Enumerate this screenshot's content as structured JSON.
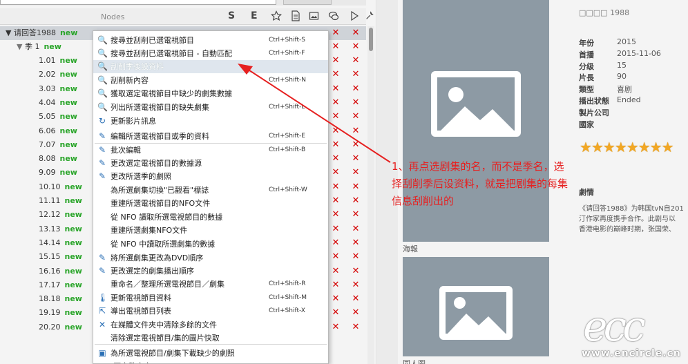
{
  "header": {
    "nodes_label": "Nodes",
    "col_s": "S",
    "col_e": "E"
  },
  "tree": {
    "show": {
      "label": "请回答1988",
      "badge": "new"
    },
    "season": {
      "label": "季 1",
      "badge": "new"
    },
    "episodes": [
      {
        "label": "1.01",
        "badge": "new"
      },
      {
        "label": "2.02",
        "badge": "new"
      },
      {
        "label": "3.03",
        "badge": "new"
      },
      {
        "label": "4.04",
        "badge": "new"
      },
      {
        "label": "5.05",
        "badge": "new"
      },
      {
        "label": "6.06",
        "badge": "new"
      },
      {
        "label": "7.07",
        "badge": "new"
      },
      {
        "label": "8.08",
        "badge": "new"
      },
      {
        "label": "9.09",
        "badge": "new"
      },
      {
        "label": "10.10",
        "badge": "new"
      },
      {
        "label": "11.11",
        "badge": "new"
      },
      {
        "label": "12.12",
        "badge": "new"
      },
      {
        "label": "13.13",
        "badge": "new"
      },
      {
        "label": "14.14",
        "badge": "new"
      },
      {
        "label": "15.15",
        "badge": "new"
      },
      {
        "label": "16.16",
        "badge": "new"
      },
      {
        "label": "17.17",
        "badge": "new"
      },
      {
        "label": "18.18",
        "badge": "new"
      },
      {
        "label": "19.19",
        "badge": "new"
      },
      {
        "label": "20.20",
        "badge": "new"
      }
    ],
    "x_mark": "✕"
  },
  "menu": {
    "items": [
      {
        "icon": "search-icon",
        "glyph": "🔍",
        "text": "搜尋並刮削已選電視節目",
        "shortcut": "Ctrl+Shift-S"
      },
      {
        "icon": "search-icon",
        "glyph": "🔍",
        "text": "搜尋並刮削已選電視節目 - 自動匹配",
        "shortcut": "Ctrl+Shift-F"
      },
      {
        "icon": "search-icon",
        "glyph": "🔍",
        "text": "刮削季後設資料",
        "shortcut": ""
      },
      {
        "icon": "search-icon",
        "glyph": "🔍",
        "text": "刮削新內容",
        "shortcut": "Ctrl+Shift-N"
      },
      {
        "icon": "search-icon",
        "glyph": "🔍",
        "text": "獲取選定電視節目中缺少的劇集數據",
        "shortcut": ""
      },
      {
        "icon": "search-icon",
        "glyph": "🔍",
        "text": "列出所選電視節目的缺失劇集",
        "shortcut": "Ctrl+Shift-L"
      },
      {
        "icon": "refresh-icon",
        "glyph": "↻",
        "text": "更新影片訊息",
        "shortcut": ""
      },
      {
        "icon": "edit-icon",
        "glyph": "✎",
        "text": "編輯所選電視節目或季的資料",
        "shortcut": "Ctrl+Shift-E"
      },
      {
        "icon": "edit-icon",
        "glyph": "✎",
        "text": "批次編輯",
        "shortcut": "Ctrl+Shift-B"
      },
      {
        "icon": "edit-icon",
        "glyph": "✎",
        "text": "更改選定電視節目的數據源",
        "shortcut": ""
      },
      {
        "icon": "edit-icon",
        "glyph": "✎",
        "text": "更改所選季的劇照",
        "shortcut": ""
      },
      {
        "icon": "",
        "glyph": "",
        "text": "為所選劇集切換\"已觀看\"標誌",
        "shortcut": "Ctrl+Shift-W"
      },
      {
        "icon": "",
        "glyph": "",
        "text": "重建所選電視節目的NFO文件",
        "shortcut": ""
      },
      {
        "icon": "",
        "glyph": "",
        "text": "從 NFO 讀取所選電視節目的數據",
        "shortcut": ""
      },
      {
        "icon": "",
        "glyph": "",
        "text": "重建所選劇集NFO文件",
        "shortcut": ""
      },
      {
        "icon": "",
        "glyph": "",
        "text": "從 NFO 中讀取所選劇集的數據",
        "shortcut": ""
      },
      {
        "icon": "edit-icon",
        "glyph": "✎",
        "text": "將所選劇集更改為DVD順序",
        "shortcut": ""
      },
      {
        "icon": "edit-icon",
        "glyph": "✎",
        "text": "更改選定的劇集播出順序",
        "shortcut": ""
      },
      {
        "icon": "",
        "glyph": "",
        "text": "重命名／整理所選電視節目／劇集",
        "shortcut": "Ctrl+Shift-R"
      },
      {
        "icon": "thermometer-icon",
        "glyph": "🌡",
        "text": "更新電視節目資料",
        "shortcut": "Ctrl+Shift-M"
      },
      {
        "icon": "export-icon",
        "glyph": "⇱",
        "text": "導出電視節目列表",
        "shortcut": "Ctrl+Shift-X"
      },
      {
        "icon": "close-icon",
        "glyph": "✕",
        "text": "在媒體文件夾中清除多餘的文件",
        "shortcut": ""
      },
      {
        "icon": "",
        "glyph": "",
        "text": "清除選定電視節目/集的圖片快取",
        "shortcut": ""
      },
      {
        "icon": "image-icon",
        "glyph": "▣",
        "text": "為所選電視節目/劇集下載缺少的劇照",
        "shortcut": ""
      },
      {
        "icon": "",
        "glyph": "",
        "text": "(不完整文字)",
        "shortcut": ""
      }
    ]
  },
  "details": {
    "subtitle": "□□□□ 1988",
    "fields": [
      {
        "label": "年份",
        "value": "2015"
      },
      {
        "label": "首播",
        "value": "2015-11-06"
      },
      {
        "label": "分级",
        "value": "15"
      },
      {
        "label": "片長",
        "value": "90"
      },
      {
        "label": "類型",
        "value": "喜剧"
      },
      {
        "label": "播出狀態",
        "value": "Ended"
      },
      {
        "label": "製片公司",
        "value": ""
      },
      {
        "label": "國家",
        "value": ""
      }
    ],
    "rating_stars": 8,
    "plot_heading": "劇情",
    "plot_lines": [
      "《请回答1988》为韩国tvN自201",
      "汀作家再度携手合作。此剧与以",
      "香港电影的巅峰时期，张国荣、"
    ],
    "poster_caption": "海報",
    "fanart_caption": "同人圖"
  },
  "annotation": {
    "text": "1、再点选剧集的名，而不是季名，选择刮削季后设资料，就是把剧集的每集信息刮削出的"
  },
  "watermark": {
    "logo": "ecc",
    "url": "www.encircle.cn"
  },
  "colors": {
    "new_badge": "#2aa52a",
    "x_mark": "#d40000",
    "annotation": "#e62020",
    "poster_bg": "#8d9aa4",
    "star": "#f2a724"
  }
}
